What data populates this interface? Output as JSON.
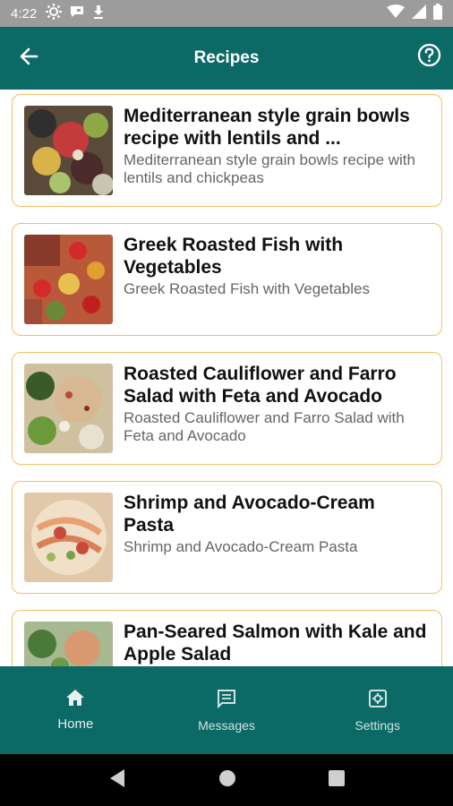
{
  "status_bar": {
    "time": "4:22",
    "left_icons": [
      "brightness-icon",
      "chat-bubble-icon",
      "download-icon"
    ],
    "right_icons": [
      "wifi-icon",
      "signal-icon",
      "battery-icon"
    ]
  },
  "app_bar": {
    "title": "Recipes",
    "back_icon": "arrow-left-icon",
    "help_icon": "help-circle-icon"
  },
  "recipes": [
    {
      "title": "Mediterranean style grain bowls recipe with lentils and ...",
      "subtitle": "Mediterranean style grain bowls recipe with lentils and chickpeas"
    },
    {
      "title": "Greek Roasted Fish with Vegetables",
      "subtitle": "Greek Roasted Fish with Vegetables"
    },
    {
      "title": "Roasted Cauliflower and Farro Salad with Feta and Avocado",
      "subtitle": "Roasted Cauliflower and Farro Salad with Feta and Avocado"
    },
    {
      "title": "Shrimp and Avocado-Cream Pasta",
      "subtitle": "Shrimp and Avocado-Cream Pasta"
    },
    {
      "title": "Pan-Seared Salmon with Kale and Apple Salad",
      "subtitle": ""
    }
  ],
  "bottom_nav": {
    "items": [
      {
        "label": "Home",
        "icon": "home-icon",
        "active": true
      },
      {
        "label": "Messages",
        "icon": "message-icon",
        "active": false
      },
      {
        "label": "Settings",
        "icon": "settings-icon",
        "active": false
      }
    ]
  },
  "system_nav": [
    "back-triangle-icon",
    "home-circle-icon",
    "recents-square-icon"
  ],
  "colors": {
    "primary": "#0b6a66",
    "card_border": "#f3c063",
    "status_bar": "#9c9c9c"
  }
}
